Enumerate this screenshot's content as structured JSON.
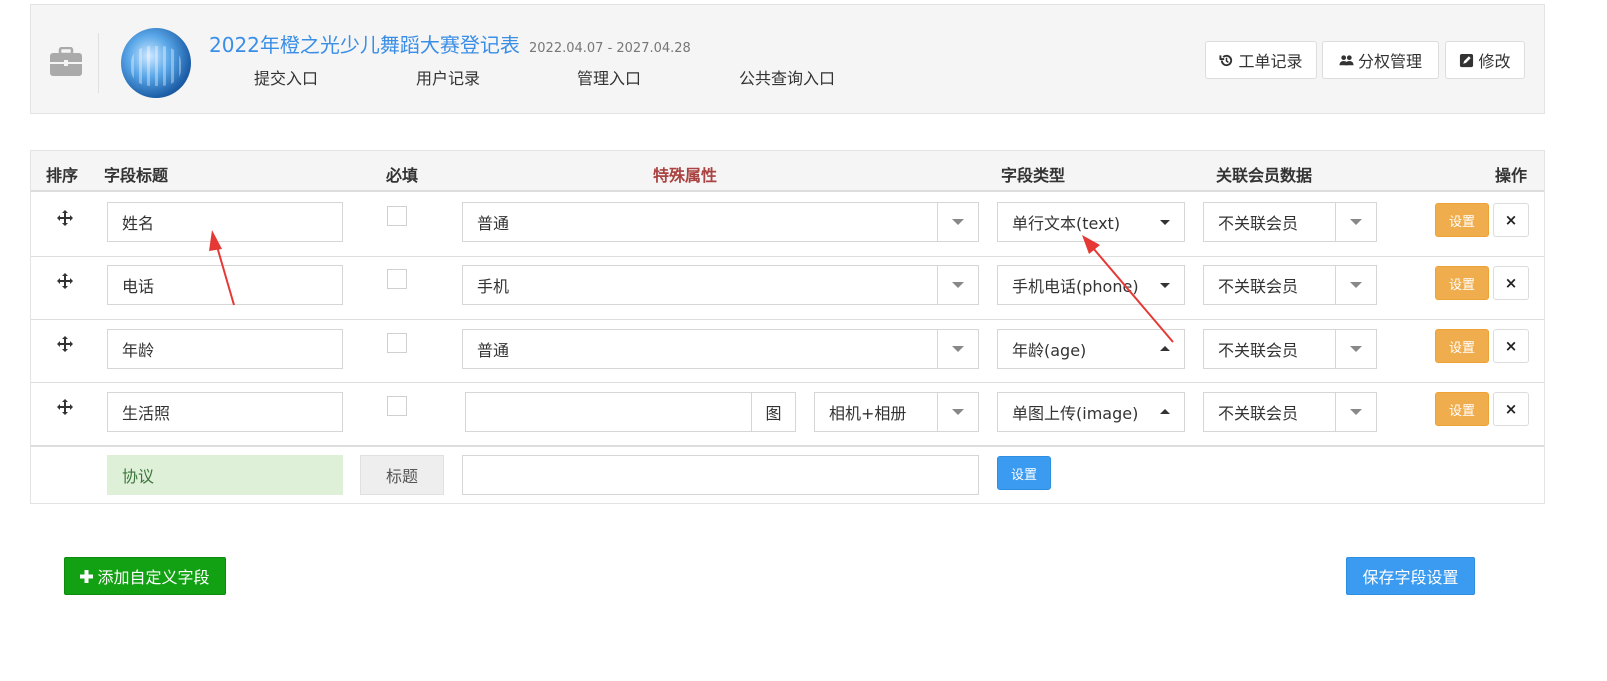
{
  "header": {
    "title": "2022年橙之光少儿舞蹈大赛登记表",
    "date_range": "2022.04.07 - 2027.04.28",
    "nav": [
      "提交入口",
      "用户记录",
      "管理入口",
      "公共查询入口"
    ],
    "buttons": {
      "work_order": "工单记录",
      "permissions": "分权管理",
      "edit": "修改"
    }
  },
  "table": {
    "headers": {
      "order": "排序",
      "field_title": "字段标题",
      "required": "必填",
      "special": "特殊属性",
      "field_type": "字段类型",
      "member_data": "关联会员数据",
      "actions": "操作"
    },
    "rows": [
      {
        "title": "姓名",
        "special": "普通",
        "type": "单行文本(text)",
        "member": "不关联会员",
        "set": "设置",
        "delete": "×"
      },
      {
        "title": "电话",
        "special": "手机",
        "type": "手机电话(phone)",
        "member": "不关联会员",
        "set": "设置",
        "delete": "×"
      },
      {
        "title": "年龄",
        "special": "普通",
        "type": "年龄(age)",
        "member": "不关联会员",
        "set": "设置",
        "delete": "×"
      },
      {
        "title": "生活照",
        "special_input": "",
        "special_addon": "图",
        "special_select": "相机+相册",
        "type": "单图上传(image)",
        "member": "不关联会员",
        "set": "设置",
        "delete": "×"
      }
    ],
    "agreement": {
      "title": "协议",
      "label": "标题",
      "value": "",
      "set": "设置"
    }
  },
  "footer": {
    "add_field": "添加自定义字段",
    "save": "保存字段设置"
  },
  "colors": {
    "accent_blue": "#3a9bf0",
    "warning": "#f0ad4e",
    "success": "#12a112",
    "special_red": "#a94442",
    "arrow": "#e53935"
  }
}
